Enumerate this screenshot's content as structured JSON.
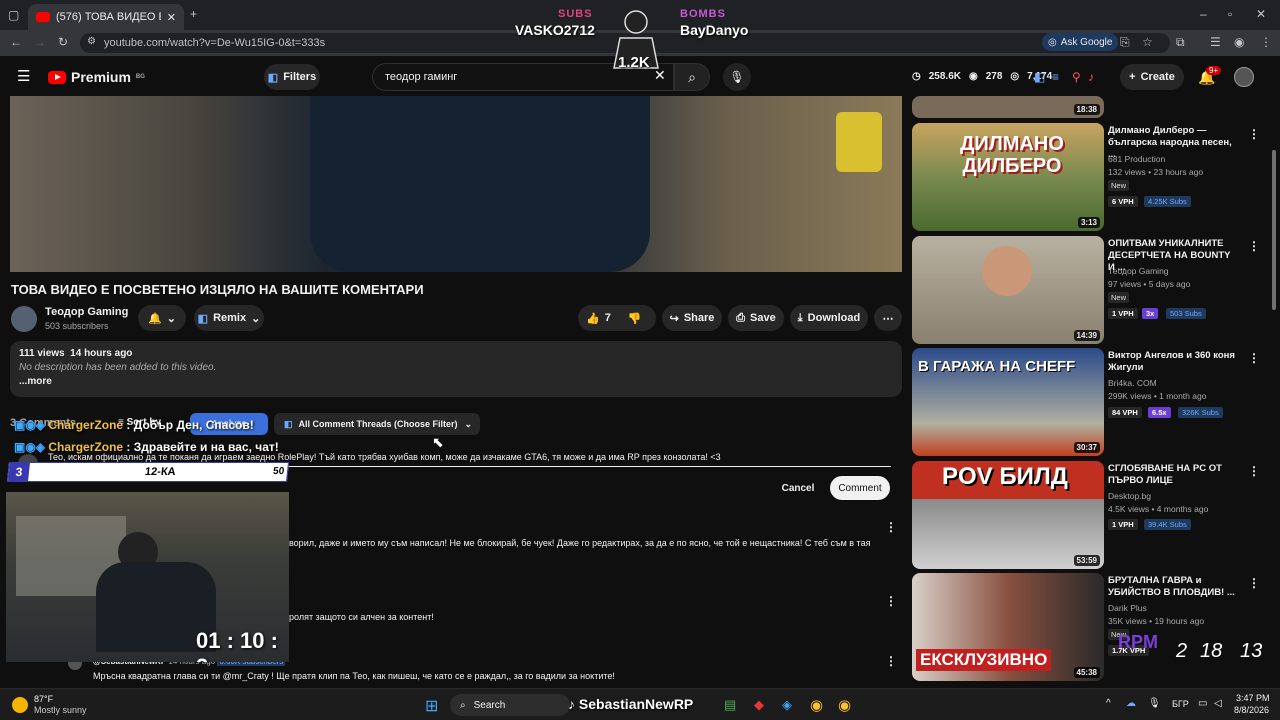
{
  "browser": {
    "tab_title": "(576) ТОВА ВИДЕО Е ПОСВЕТЕ",
    "url": "youtube.com/watch?v=De-Wu15IG-0&t=333s",
    "ask_google": "Ask Google"
  },
  "header": {
    "logo": "Premium",
    "logo_region": "BG",
    "filters": "Filters",
    "search_value": "теодор гаминг",
    "stats": [
      "258.6K",
      "278",
      "7,174"
    ],
    "create": "Create",
    "notif_count": "9+"
  },
  "video": {
    "title": "ТОВА ВИДЕО Е ПОСВЕТЕНО ИЗЦЯЛО НА ВАШИТЕ КОМЕНТАРИ",
    "channel": "Теодор Gaming",
    "subscribers": "503 subscribers",
    "remix": "Remix",
    "likes": "7",
    "share": "Share",
    "save": "Save",
    "download": "Download",
    "views": "111 views",
    "age": "14 hours ago",
    "no_description": "No description has been added to this video.",
    "more": "...more"
  },
  "comments": {
    "toolbar_count": "3 Comments",
    "sort_by": "Sort by",
    "analyze": "Analyze",
    "filter": "All Comment Threads (Choose Filter)",
    "draft": "Тео, искам официално да те поканя да играем заедно RolePlay! Тъй като трябва хуибав комп, може да изчакаме GTA6, тя може и да има RP през конзолата! <3",
    "cancel": "Cancel",
    "submit": "Comment",
    "comment1_text": "ворил, даже и името му съм написал! Не ме блокирай, бе чуек! Даже го редактирах, за да е по ясно, че той е нещастника! С теб съм в тая",
    "comment2_text": "ролят защото си алчен за контент!",
    "comment3_author": "@SebastianNewRP",
    "comment3_age": "14 hours ago",
    "comment3_subs": "6.63K subscribers",
    "comment3_text": "Мръсна квадратна глава си ти @mr_Craty ! Ще пратя клип па Тео, как пишеш, че като се е раждал,, за го вадили за ноктите!"
  },
  "sidebar": [
    {
      "title": "",
      "channel": "",
      "meta": "",
      "duration": "18:38"
    },
    {
      "title": "Дилмано Дилберо — българска народна песен, ...",
      "channel": "681 Production",
      "meta": "132 views • 23 hours ago",
      "new": "New",
      "vph": "6 VPH",
      "subs": "4.25K Subs",
      "duration": "3:13",
      "thumb_text": "ДИЛМАНО ДИЛБЕРО"
    },
    {
      "title": "ОПИТВАМ УНИКАЛНИТЕ ДЕСЕРТЧЕТА НА BOUNTY И ...",
      "channel": "Теодор Gaming",
      "meta": "97 views • 5 days ago",
      "new": "New",
      "vph": "1 VPH",
      "mult": "3x",
      "subs": "503 Subs",
      "duration": "14:39"
    },
    {
      "title": "Виктор Ангелов и 360 коня Жигули",
      "channel": "Bri4ka. COM",
      "meta": "299K views • 1 month ago",
      "vph": "84 VPH",
      "mult": "6.5x",
      "subs": "326K Subs",
      "duration": "30:37",
      "thumb_text": "В ГАРАЖА НА CHEFF"
    },
    {
      "title": "СГЛОБЯВАНЕ НА PC ОТ ПЪРВО ЛИЦЕ",
      "channel": "Desktop.bg",
      "meta": "4.5K views • 4 months ago",
      "vph": "1 VPH",
      "subs": "39.4K Subs",
      "duration": "53:59",
      "thumb_text": "POV БИЛД"
    },
    {
      "title": "БРУТАЛНА ГАВРА и УБИЙСТВО В ПЛОВДИВ! ...",
      "channel": "Darik Plus",
      "meta": "35K views • 19 hours ago",
      "new": "New",
      "vph": "1.7K VPH",
      "duration": "45:38",
      "thumb_text": "ЕКСКЛУЗИВНО"
    }
  ],
  "overlay": {
    "subs_label": "SUBS",
    "bombs_label": "BOMBS",
    "subs_name": "VASKO2712",
    "bombs_name": "BayDanyo",
    "counter": "1.2K",
    "chat1_user": "ChargerZone",
    "chat1_text": ": Добър Ден, Спасов!",
    "chat2_user": "ChargerZone",
    "chat2_text": ": Здравейте и на вас, чат!",
    "rank_num": "3",
    "rank_name": "12-КА",
    "rank_score": "50",
    "timer": "01 : 10 : 2",
    "rpm_label": "RPM",
    "rpm_values": [
      "2",
      "18",
      "13"
    ]
  },
  "taskbar": {
    "temp": "87°F",
    "weather": "Mostly sunny",
    "search": "Search",
    "streamer": "SebastianNewRP",
    "lang": "БГР",
    "time": "3:47 PM",
    "date": "8/8/2026"
  }
}
